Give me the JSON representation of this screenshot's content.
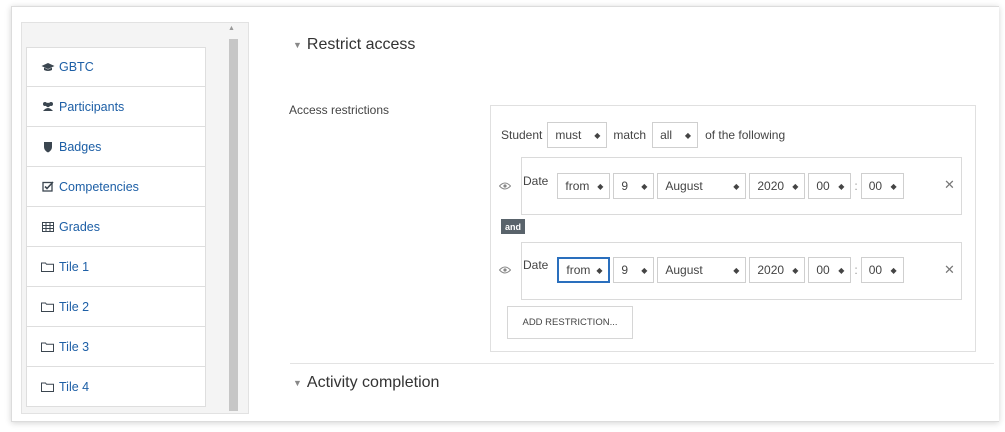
{
  "nav": {
    "items": [
      {
        "label": "GBTC",
        "icon": "graduation-cap-icon"
      },
      {
        "label": "Participants",
        "icon": "users-icon"
      },
      {
        "label": "Badges",
        "icon": "shield-icon"
      },
      {
        "label": "Competencies",
        "icon": "checkbox-icon"
      },
      {
        "label": "Grades",
        "icon": "table-icon"
      },
      {
        "label": "Tile 1",
        "icon": "folder-icon"
      },
      {
        "label": "Tile 2",
        "icon": "folder-icon"
      },
      {
        "label": "Tile 3",
        "icon": "folder-icon"
      },
      {
        "label": "Tile 4",
        "icon": "folder-icon"
      }
    ]
  },
  "sections": {
    "restrict_title": "Restrict access",
    "activity_title": "Activity completion"
  },
  "restrictions": {
    "label": "Access restrictions",
    "student_label": "Student",
    "must_value": "must",
    "match_label": "match",
    "all_value": "all",
    "following_label": "of the following",
    "and_label": "and",
    "add_button": "ADD RESTRICTION...",
    "conditions": [
      {
        "type": "Date",
        "direction": "from",
        "day": "9",
        "month": "August",
        "year": "2020",
        "hour": "00",
        "minute": "00"
      },
      {
        "type": "Date",
        "direction": "from",
        "day": "9",
        "month": "August",
        "year": "2020",
        "hour": "00",
        "minute": "00"
      }
    ]
  },
  "colors": {
    "link": "#1d5fa6",
    "badge": "#59636b",
    "focus": "#2a6fbd"
  }
}
